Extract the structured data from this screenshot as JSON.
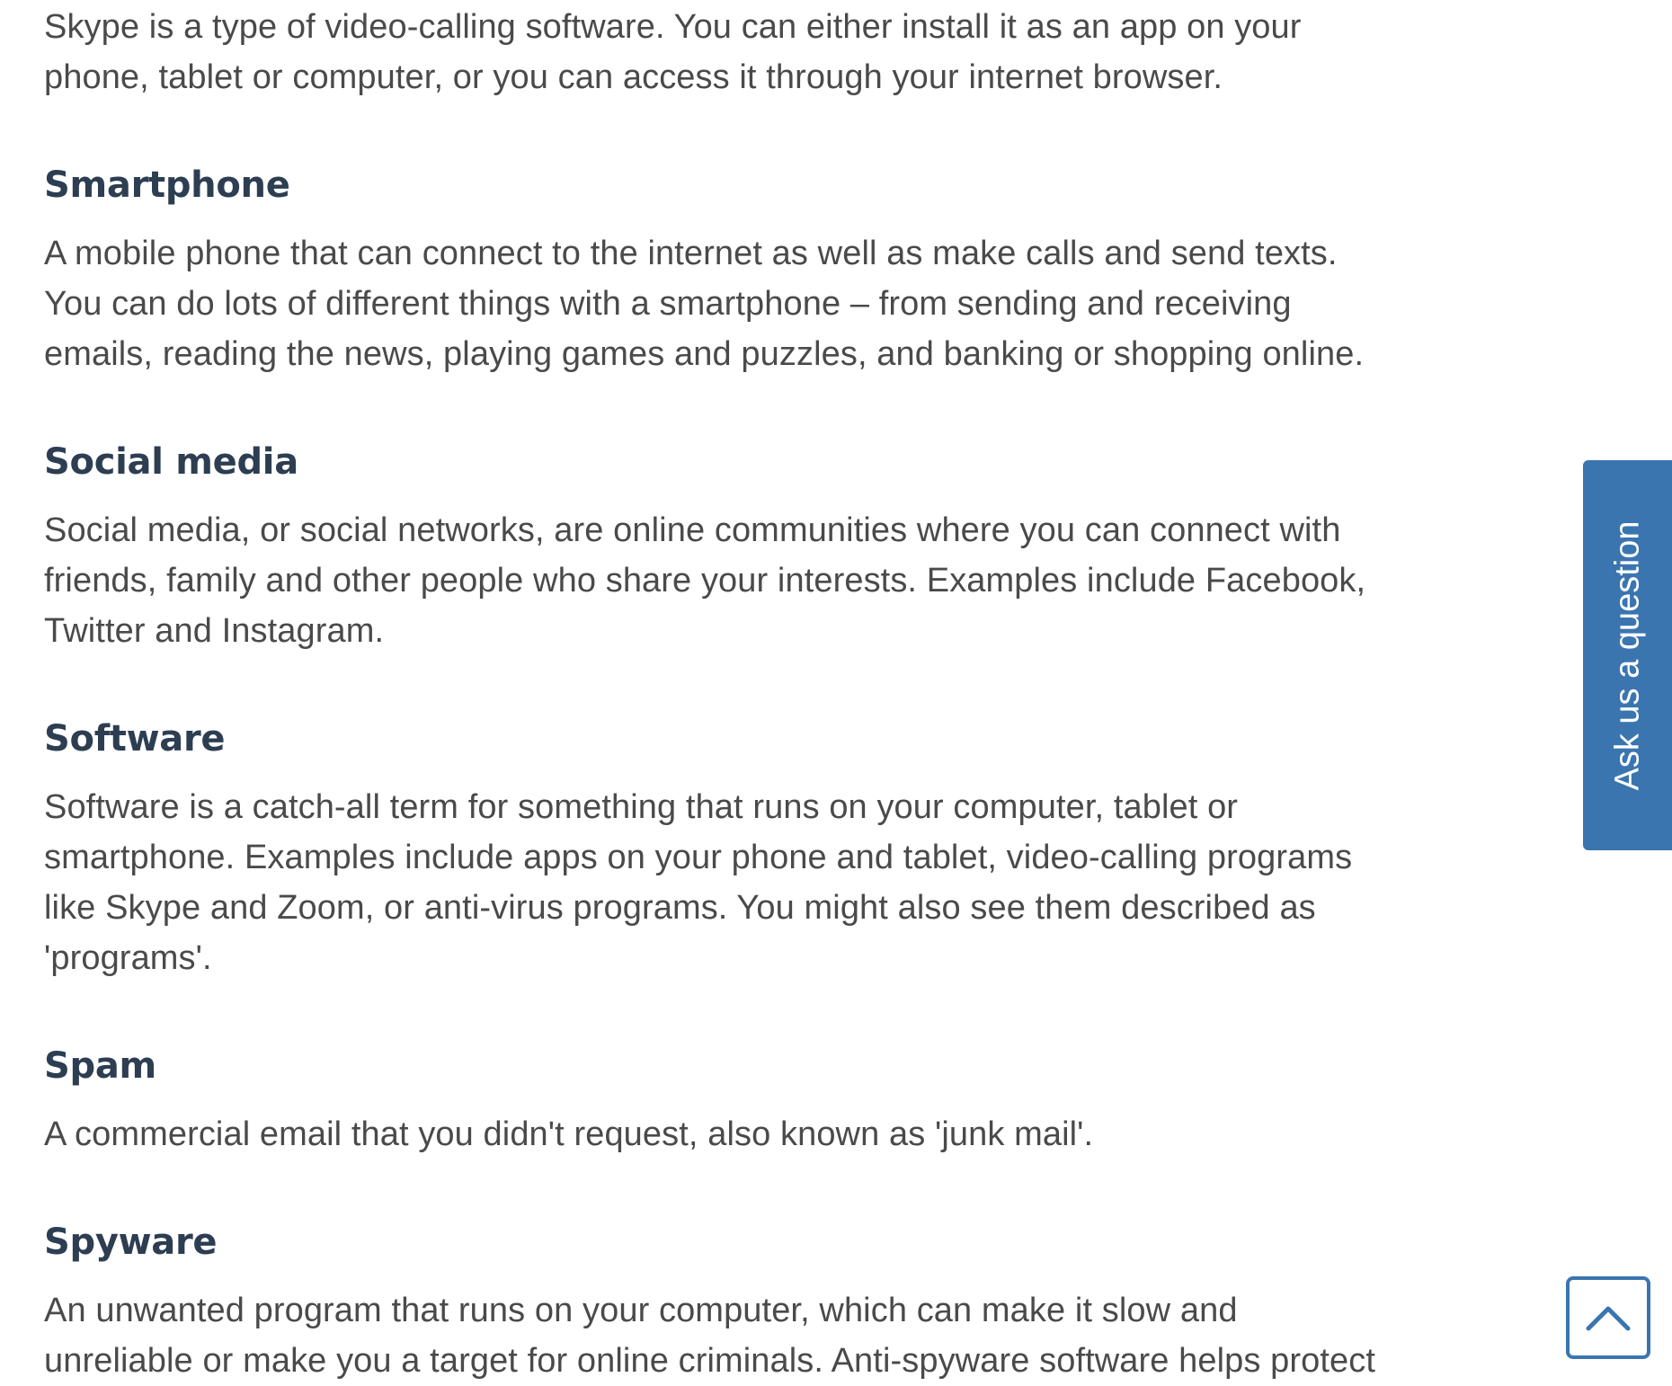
{
  "intro": {
    "text_line1": "Skype is a type of video-calling software. You can either install it as an app on your",
    "text_line2": "phone, tablet or computer, or you can access it through your internet browser."
  },
  "glossary": [
    {
      "term": "Smartphone",
      "lines": [
        "A mobile phone that can connect to the internet as well as make calls and send texts.",
        "You can do lots of different things with a smartphone – from sending and receiving",
        "emails, reading the news, playing games and puzzles, and banking or shopping online."
      ]
    },
    {
      "term": "Social media",
      "lines": [
        "Social media, or social networks, are online communities where you can connect with",
        "friends, family and other people who share your interests. Examples include Facebook,",
        "Twitter and Instagram."
      ]
    },
    {
      "term": "Software",
      "lines": [
        "Software is a catch-all term for something that runs on your computer, tablet or",
        "smartphone. Examples include apps on your phone and tablet, video-calling programs",
        "like Skype and Zoom, or anti-virus programs. You might also see them described as",
        "'programs'."
      ]
    },
    {
      "term": "Spam",
      "lines": [
        "A commercial email that you didn't request, also known as 'junk mail'."
      ]
    },
    {
      "term": "Spyware",
      "lines": [
        "An unwanted program that runs on your computer, which can make it slow and",
        "unreliable or make you a target for online criminals. Anti-spyware software helps protect"
      ]
    }
  ],
  "ask_tab": {
    "label": "Ask us a question"
  },
  "back_to_top": {
    "icon": "chevron-up-icon"
  },
  "colors": {
    "body_text": "#4a4a4a",
    "heading_text": "#2d3e52",
    "accent": "#3a75b0"
  }
}
